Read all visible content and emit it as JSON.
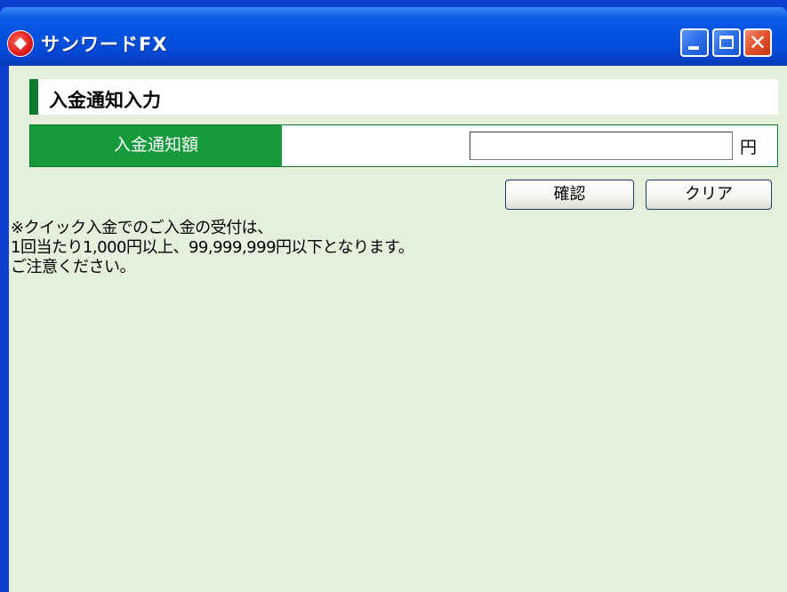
{
  "window": {
    "title": "サンワードFX",
    "icon": "app-logo-icon"
  },
  "section": {
    "title": "入金通知入力"
  },
  "form": {
    "amount_label": "入金通知額",
    "amount_value": "",
    "amount_unit": "円"
  },
  "buttons": {
    "confirm_label": "確認",
    "clear_label": "クリア"
  },
  "notice": {
    "lines": [
      "※クイック入金でのご入金の受付は、",
      "1回当たり1,000円以上、99,999,999円以下となります。",
      "ご注意ください。"
    ]
  },
  "colors": {
    "accent_green": "#169a3c",
    "dark_green": "#0b7a2a",
    "client_bg": "#e4f0dc",
    "titlebar_blue": "#0453e2"
  }
}
